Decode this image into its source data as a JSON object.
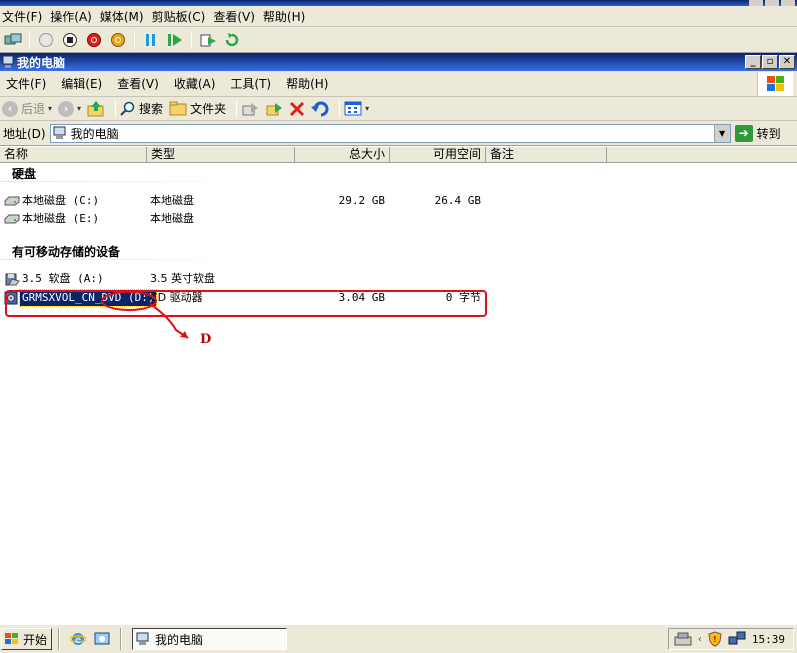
{
  "host": {
    "menu": [
      "文件(F)",
      "操作(A)",
      "媒体(M)",
      "剪贴板(C)",
      "查看(V)",
      "帮助(H)"
    ]
  },
  "window": {
    "title": "我的电脑",
    "buttons": [
      "_",
      "▫",
      "✕"
    ]
  },
  "menu": [
    "文件(F)",
    "编辑(E)",
    "查看(V)",
    "收藏(A)",
    "工具(T)",
    "帮助(H)"
  ],
  "toolbar": {
    "back_label": "后退",
    "search_label": "搜索",
    "folders_label": "文件夹"
  },
  "address": {
    "label": "地址(D)",
    "value": "我的电脑",
    "go_label": "转到"
  },
  "columns": [
    "名称",
    "类型",
    "总大小",
    "可用空间",
    "备注"
  ],
  "groups": {
    "hard_disks": {
      "title": "硬盘",
      "rows": [
        {
          "name": "本地磁盘 (C:)",
          "type": "本地磁盘",
          "size": "29.2 GB",
          "free": "26.4 GB"
        },
        {
          "name": "本地磁盘 (E:)",
          "type": "本地磁盘",
          "size": "",
          "free": ""
        }
      ]
    },
    "removable": {
      "title": "有可移动存储的设备",
      "rows": [
        {
          "name": "3.5 软盘 (A:)",
          "type": "3.5 英寸软盘",
          "size": "",
          "free": ""
        },
        {
          "name": "GRMSXVOL_CN_DVD (D:)",
          "type": "CD 驱动器",
          "size": "3.04 GB",
          "free": "0 字节"
        }
      ]
    }
  },
  "annotation": {
    "label": "D",
    "color": "#e0101a"
  },
  "taskbar": {
    "start_label": "开始",
    "task_label": "我的电脑",
    "clock": "15:39"
  }
}
